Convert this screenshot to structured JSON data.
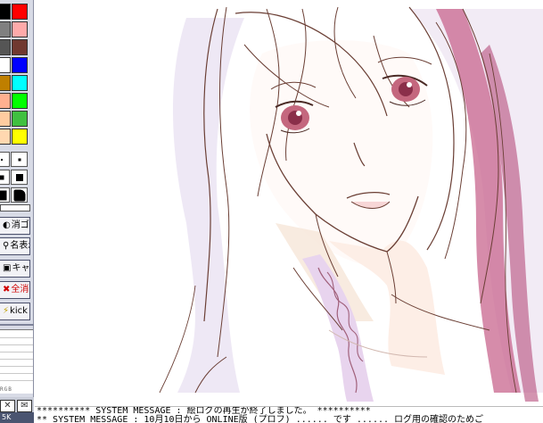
{
  "toolbar": {
    "palette": [
      "#000000",
      "#ff0000",
      "#808080",
      "#ffaaaa",
      "#555555",
      "#703830",
      "#ffffff",
      "#0000ff",
      "#bf7f00",
      "#00ffff",
      "#ffb090",
      "#00ff00",
      "#ffcca0",
      "#40c040",
      "#ffd8b0",
      "#ffff00"
    ],
    "buttons": {
      "eraser": "消ゴム",
      "name_display": "名表示",
      "capture": "キャプ",
      "clear_all": "全消し",
      "kick": "kick"
    },
    "rgb_labels": "RGB",
    "pen_size": "5K"
  },
  "chat": {
    "line1": "********** SYSTEM MESSAGE : 絵ログの再生が終了しました。 **********",
    "line2": "** SYSTEM MESSAGE : 10月10日から ONLINE版 (プロフ) ......  です ...... ログ用の確認のためご"
  }
}
